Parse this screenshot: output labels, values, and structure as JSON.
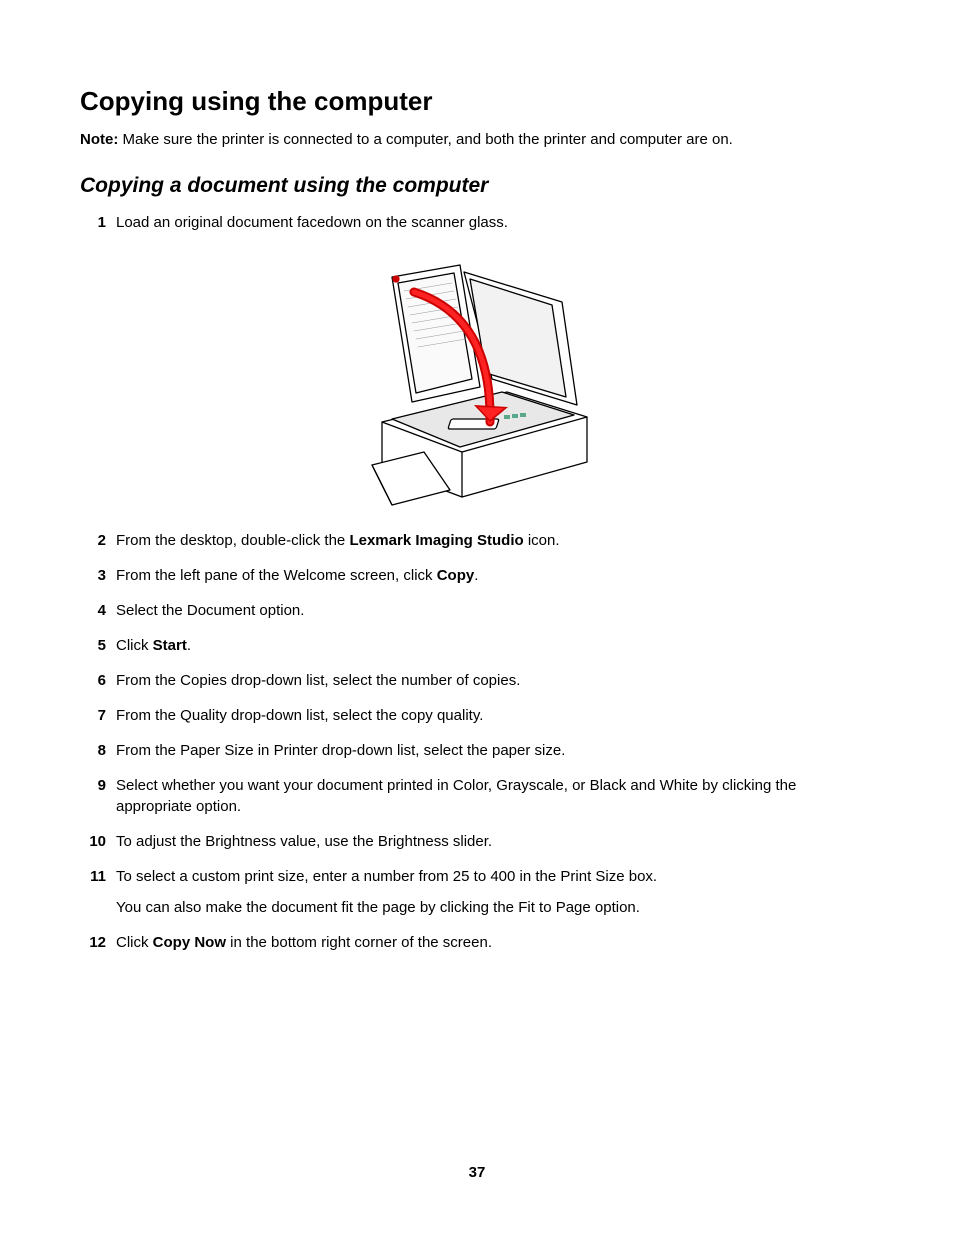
{
  "heading": "Copying using the computer",
  "note_label": "Note:",
  "note_text": " Make sure the printer is connected to a computer, and both the printer and computer are on.",
  "subheading": "Copying a document using the computer",
  "steps": {
    "s1": {
      "num": "1",
      "text": "Load an original document facedown on the scanner glass."
    },
    "s2": {
      "num": "2",
      "pre": "From the desktop, double-click the ",
      "bold": "Lexmark Imaging Studio",
      "post": " icon."
    },
    "s3": {
      "num": "3",
      "pre": "From the left pane of the Welcome screen, click ",
      "bold": "Copy",
      "post": "."
    },
    "s4": {
      "num": "4",
      "text": "Select the Document option."
    },
    "s5": {
      "num": "5",
      "pre": "Click ",
      "bold": "Start",
      "post": "."
    },
    "s6": {
      "num": "6",
      "text": "From the Copies drop-down list, select the number of copies."
    },
    "s7": {
      "num": "7",
      "text": "From the Quality drop-down list, select the copy quality."
    },
    "s8": {
      "num": "8",
      "text": "From the Paper Size in Printer drop-down list, select the paper size."
    },
    "s9": {
      "num": "9",
      "text": "Select whether you want your document printed in Color, Grayscale, or Black and White by clicking the appropriate option."
    },
    "s10": {
      "num": "10",
      "text": "To adjust the Brightness value, use the Brightness slider."
    },
    "s11": {
      "num": "11",
      "text": "To select a custom print size, enter a number from 25 to 400 in the Print Size box.",
      "text2": "You can also make the document fit the page by clicking the Fit to Page option."
    },
    "s12": {
      "num": "12",
      "pre": "Click ",
      "bold": "Copy Now",
      "post": " in the bottom right corner of the screen."
    }
  },
  "page_number": "37"
}
